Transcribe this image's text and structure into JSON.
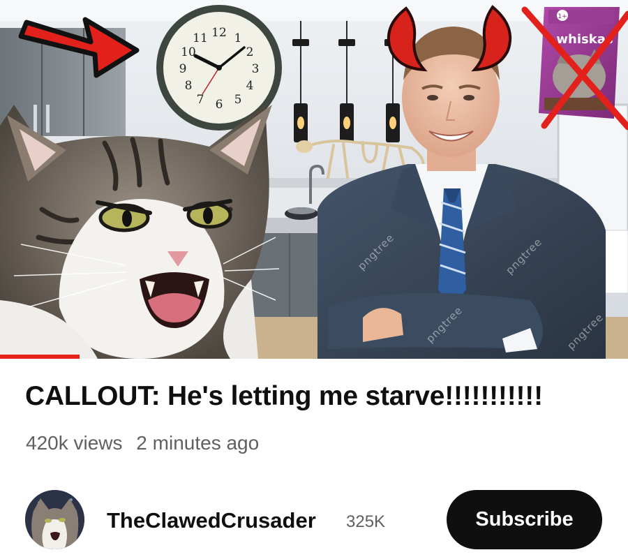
{
  "video": {
    "title": "CALLOUT: He's letting me starve!!!!!!!!!!!",
    "views": "420k views",
    "posted": "2 minutes ago",
    "watch_progress": 0.127,
    "thumbnail": {
      "subjects": [
        "angry-cat",
        "smiling-man-in-suit",
        "wall-clock",
        "cat-skeleton",
        "crossed-out-cat-food-pouch",
        "devil-horns",
        "red-arrow"
      ],
      "clock_numerals": [
        "12",
        "1",
        "2",
        "3",
        "4",
        "5",
        "6",
        "7",
        "8",
        "9",
        "10",
        "11"
      ],
      "pouch_brand": "whiskas",
      "watermark": "pngtree"
    }
  },
  "channel": {
    "name": "TheClawedCrusader",
    "subscribers": "325K",
    "subscribe_label": "Subscribe"
  },
  "colors": {
    "progress": "#e62117",
    "subscribe_bg": "#0f0f0f",
    "meta_text": "#606060"
  }
}
